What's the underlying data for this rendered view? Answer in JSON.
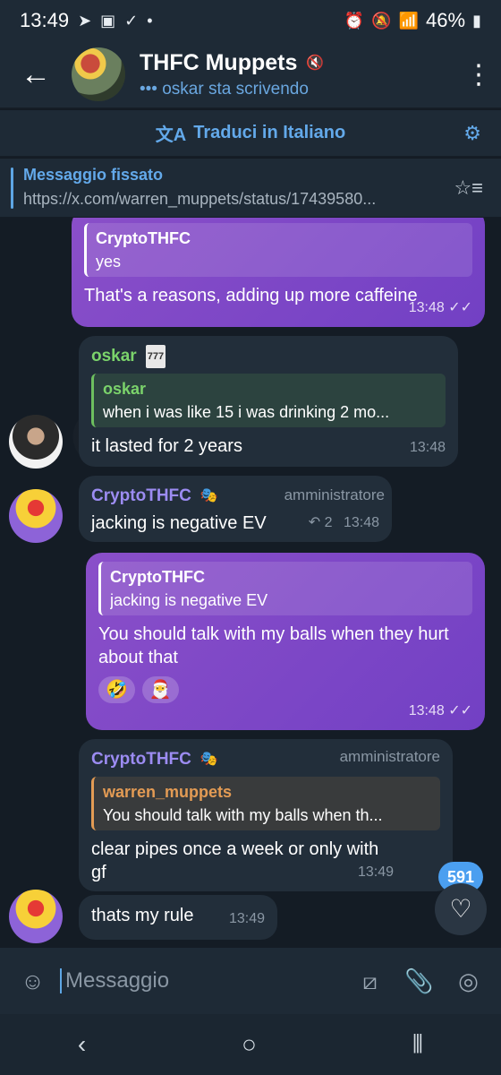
{
  "status": {
    "time": "13:49",
    "battery": "46%"
  },
  "header": {
    "title": "THFC Muppets",
    "subtitle": "••• oskar sta scrivendo"
  },
  "translate_bar": {
    "label": "Traduci in Italiano"
  },
  "pinned": {
    "title": "Messaggio fissato",
    "url": "https://x.com/warren_muppets/status/17439580..."
  },
  "messages": [
    {
      "quote_name": "CryptoTHFC",
      "quote_text": "yes",
      "text": "That's a reasons, adding up more caffeine",
      "time": "13:48"
    },
    {
      "sender": "oskar",
      "sender_tag": "777",
      "quote_name": "oskar",
      "quote_text": "when i was like 15 i was drinking 2 mo...",
      "text": "it lasted for 2 years",
      "time": "13:48"
    },
    {
      "sender": "CryptoTHFC",
      "role": "amministratore",
      "text": "jacking is negative EV",
      "replies": "↶ 2",
      "time": "13:48"
    },
    {
      "quote_name": "CryptoTHFC",
      "quote_text": "jacking is negative EV",
      "text": "You should talk with my balls when they hurt about that",
      "reactions": [
        "🤣",
        "🎅"
      ],
      "time": "13:48"
    },
    {
      "sender": "CryptoTHFC",
      "role": "amministratore",
      "quote_name": "warren_muppets",
      "quote_text": "You should talk with my balls when th...",
      "text": "clear pipes once a week or only with gf",
      "time": "13:49"
    },
    {
      "text": "thats my rule",
      "time": "13:49"
    }
  ],
  "unread_count": "591",
  "composer": {
    "placeholder": "Messaggio"
  },
  "colors": {
    "accent": "#63a9ea",
    "outgoing": "#7b45c8",
    "incoming": "#222e3a"
  }
}
